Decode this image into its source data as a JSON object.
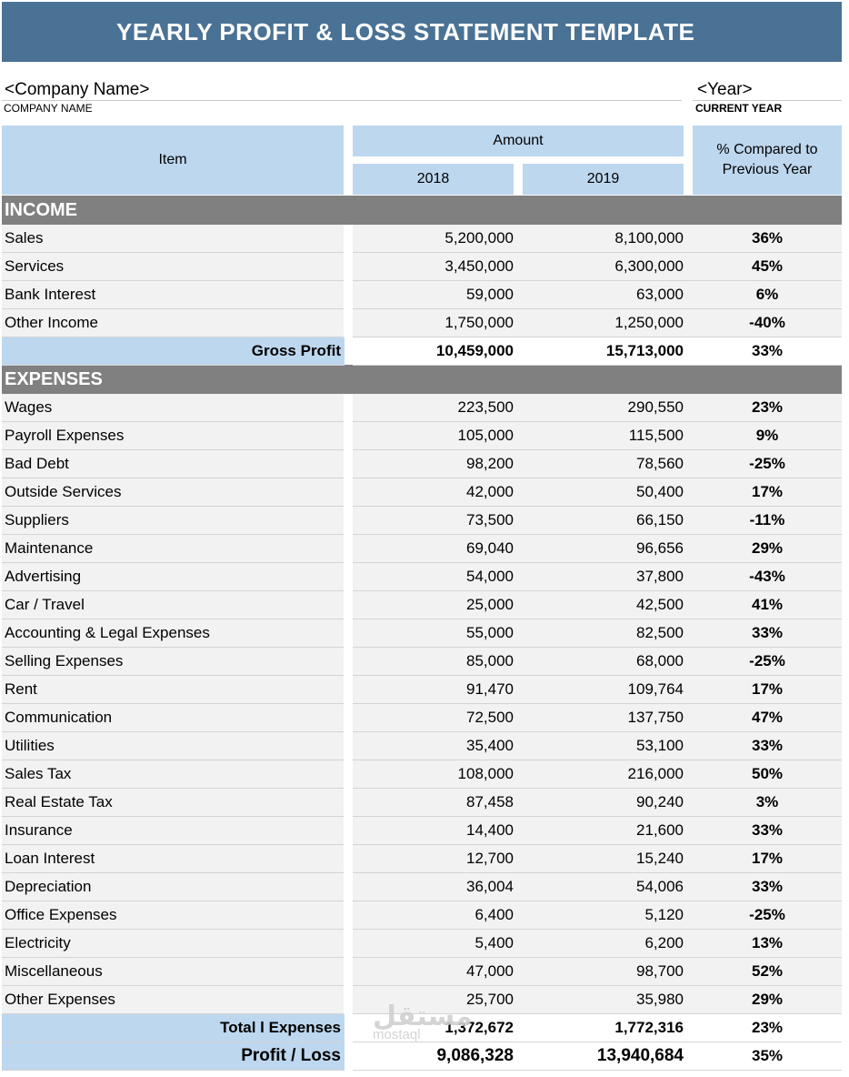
{
  "title": "YEARLY PROFIT & LOSS STATEMENT TEMPLATE",
  "company": {
    "value": "<Company Name>",
    "label": "COMPANY NAME"
  },
  "year": {
    "value": "<Year>",
    "label": "CURRENT YEAR"
  },
  "header": {
    "item": "Item",
    "amount": "Amount",
    "year1": "2018",
    "year2": "2019",
    "pct_line1": "% Compared to",
    "pct_line2": "Previous Year"
  },
  "income": {
    "title": "INCOME",
    "rows": [
      {
        "item": "Sales",
        "y1": "5,200,000",
        "y2": "8,100,000",
        "pct": "36%"
      },
      {
        "item": "Services",
        "y1": "3,450,000",
        "y2": "6,300,000",
        "pct": "45%"
      },
      {
        "item": "Bank Interest",
        "y1": "59,000",
        "y2": "63,000",
        "pct": "6%"
      },
      {
        "item": "Other Income",
        "y1": "1,750,000",
        "y2": "1,250,000",
        "pct": "-40%"
      }
    ],
    "total": {
      "item": "Gross Profit",
      "y1": "10,459,000",
      "y2": "15,713,000",
      "pct": "33%"
    }
  },
  "expenses": {
    "title": "EXPENSES",
    "rows": [
      {
        "item": "Wages",
        "y1": "223,500",
        "y2": "290,550",
        "pct": "23%"
      },
      {
        "item": "Payroll Expenses",
        "y1": "105,000",
        "y2": "115,500",
        "pct": "9%"
      },
      {
        "item": "Bad Debt",
        "y1": "98,200",
        "y2": "78,560",
        "pct": "-25%"
      },
      {
        "item": "Outside Services",
        "y1": "42,000",
        "y2": "50,400",
        "pct": "17%"
      },
      {
        "item": "Suppliers",
        "y1": "73,500",
        "y2": "66,150",
        "pct": "-11%"
      },
      {
        "item": "Maintenance",
        "y1": "69,040",
        "y2": "96,656",
        "pct": "29%"
      },
      {
        "item": "Advertising",
        "y1": "54,000",
        "y2": "37,800",
        "pct": "-43%"
      },
      {
        "item": "Car / Travel",
        "y1": "25,000",
        "y2": "42,500",
        "pct": "41%"
      },
      {
        "item": "Accounting & Legal Expenses",
        "y1": "55,000",
        "y2": "82,500",
        "pct": "33%"
      },
      {
        "item": "Selling Expenses",
        "y1": "85,000",
        "y2": "68,000",
        "pct": "-25%"
      },
      {
        "item": "Rent",
        "y1": "91,470",
        "y2": "109,764",
        "pct": "17%"
      },
      {
        "item": "Communication",
        "y1": "72,500",
        "y2": "137,750",
        "pct": "47%"
      },
      {
        "item": "Utilities",
        "y1": "35,400",
        "y2": "53,100",
        "pct": "33%"
      },
      {
        "item": "Sales Tax",
        "y1": "108,000",
        "y2": "216,000",
        "pct": "50%"
      },
      {
        "item": "Real Estate Tax",
        "y1": "87,458",
        "y2": "90,240",
        "pct": "3%"
      },
      {
        "item": "Insurance",
        "y1": "14,400",
        "y2": "21,600",
        "pct": "33%"
      },
      {
        "item": "Loan Interest",
        "y1": "12,700",
        "y2": "15,240",
        "pct": "17%"
      },
      {
        "item": "Depreciation",
        "y1": "36,004",
        "y2": "54,006",
        "pct": "33%"
      },
      {
        "item": "Office Expenses",
        "y1": "6,400",
        "y2": "5,120",
        "pct": "-25%"
      },
      {
        "item": "Electricity",
        "y1": "5,400",
        "y2": "6,200",
        "pct": "13%"
      },
      {
        "item": "Miscellaneous",
        "y1": "47,000",
        "y2": "98,700",
        "pct": "52%"
      },
      {
        "item": "Other Expenses",
        "y1": "25,700",
        "y2": "35,980",
        "pct": "29%"
      }
    ],
    "total": {
      "item": "Total l Expenses",
      "y1": "1,372,672",
      "y2": "1,772,316",
      "pct": "23%"
    }
  },
  "profit_loss": {
    "item": "Profit / Loss",
    "y1": "9,086,328",
    "y2": "13,940,684",
    "pct": "35%"
  },
  "watermark": {
    "main": "مستقل",
    "sub": "mostaql"
  }
}
